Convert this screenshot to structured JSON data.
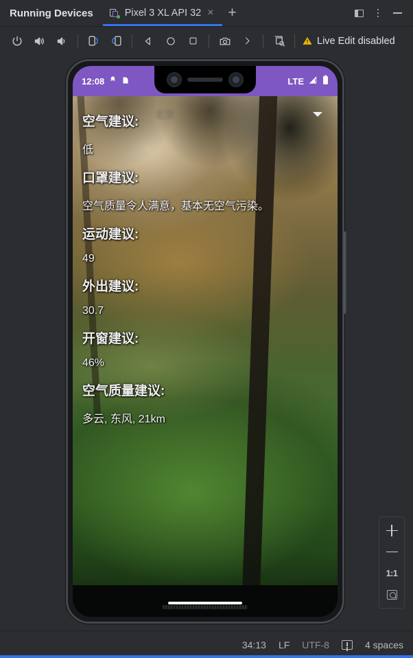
{
  "window": {
    "title": "Running Devices",
    "tabs": [
      {
        "label": "Pixel 3 XL API 32",
        "icon": "device-icon",
        "close": "×",
        "active": true
      }
    ],
    "new_tab_label": "+",
    "controls": [
      {
        "name": "split-panel-button",
        "icon": "panel-icon"
      },
      {
        "name": "more-options-button",
        "icon": "vertical-dots-icon"
      },
      {
        "name": "minimize-button",
        "icon": "minimize-icon"
      }
    ]
  },
  "toolbar": {
    "buttons": [
      {
        "name": "power-button",
        "icon": "power-icon",
        "tooltip": "Power"
      },
      {
        "name": "volume-up-button",
        "icon": "volume-up-icon",
        "tooltip": "Volume Up"
      },
      {
        "name": "volume-down-button",
        "icon": "volume-down-icon",
        "tooltip": "Volume Down"
      },
      {
        "name": "rotate-left-button",
        "icon": "rotate-left-icon",
        "tooltip": "Rotate Left"
      },
      {
        "name": "rotate-right-button",
        "icon": "rotate-right-icon",
        "tooltip": "Rotate Right"
      },
      {
        "name": "back-button",
        "icon": "back-triangle-icon",
        "tooltip": "Back"
      },
      {
        "name": "home-button",
        "icon": "home-circle-icon",
        "tooltip": "Home"
      },
      {
        "name": "overview-button",
        "icon": "overview-square-icon",
        "tooltip": "Overview"
      },
      {
        "name": "screenshot-button",
        "icon": "camera-icon",
        "tooltip": "Take Screenshot"
      },
      {
        "name": "more-toolbar-button",
        "icon": "chevron-right-icon",
        "tooltip": "More"
      },
      {
        "name": "ui-inspector-button",
        "icon": "device-screen-search-icon",
        "tooltip": "UI Check"
      }
    ],
    "live_edit_status": "Live Edit disabled",
    "warning_color": "#f0b400"
  },
  "device": {
    "status_bar": {
      "time": "12:08",
      "left_icons": [
        "notification-icon",
        "sd-card-icon"
      ],
      "network": "LTE",
      "right_icons": [
        "signal-warning-icon",
        "battery-icon"
      ],
      "background_color": "#7e57c2"
    },
    "app": {
      "spinner": {
        "value": "北京",
        "arrow": "▼"
      },
      "rows": [
        {
          "label": "空气建议:",
          "value": "低"
        },
        {
          "label": "口罩建议:",
          "value": "空气质量令人满意，基本无空气污染。"
        },
        {
          "label": "运动建议:",
          "value": "49"
        },
        {
          "label": "外出建议:",
          "value": "30.7"
        },
        {
          "label": "开窗建议:",
          "value": "46%"
        },
        {
          "label": "空气质量建议:",
          "value": "多云, 东风, 21km"
        }
      ]
    }
  },
  "zoom_controls": {
    "zoom_in": "+",
    "zoom_out": "−",
    "actual_size": "1:1",
    "fit_to_screen": "fit-icon"
  },
  "status_bar": {
    "position": "34:13",
    "line_separator": "LF",
    "encoding": "UTF-8",
    "inspection_icon": "inspection-icon",
    "indent": "4 spaces"
  },
  "colors": {
    "accent": "#3574f0",
    "background": "#2b2d30",
    "device_accent": "#7e57c2",
    "warning": "#f0b400"
  }
}
